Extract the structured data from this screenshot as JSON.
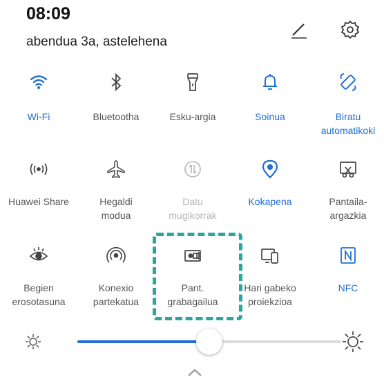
{
  "status": {
    "time": "08:09",
    "date": "abendua 3a, astelehena"
  },
  "header_icons": [
    "edit-icon",
    "settings-gear-icon"
  ],
  "tiles": [
    {
      "label": "Wi-Fi",
      "icon": "wifi-icon",
      "state": "active"
    },
    {
      "label": "Bluetootha",
      "icon": "bluetooth-icon",
      "state": "off"
    },
    {
      "label": "Esku-argia",
      "icon": "flashlight-icon",
      "state": "off"
    },
    {
      "label": "Soinua",
      "icon": "bell-icon",
      "state": "active"
    },
    {
      "label": "Biratu\nautomatikoki",
      "icon": "auto-rotate-icon",
      "state": "active"
    },
    {
      "label": "Huawei Share",
      "icon": "huawei-share-icon",
      "state": "off"
    },
    {
      "label": "Hegaldi\nmodua",
      "icon": "airplane-icon",
      "state": "off"
    },
    {
      "label": "Datu\nmugikorrak",
      "icon": "mobile-data-icon",
      "state": "disabled"
    },
    {
      "label": "Kokapena",
      "icon": "location-icon",
      "state": "active"
    },
    {
      "label": "Pantaila-\nargazkia",
      "icon": "screenshot-icon",
      "state": "off"
    },
    {
      "label": "Begien\nerosotasuna",
      "icon": "eye-comfort-icon",
      "state": "off"
    },
    {
      "label": "Konexio\npartekatua",
      "icon": "hotspot-icon",
      "state": "off"
    },
    {
      "label": "Pant.\ngrabagailua",
      "icon": "screen-recorder-icon",
      "state": "off"
    },
    {
      "label": "Hari gabeko\nproiekzioa",
      "icon": "wireless-projection-icon",
      "state": "off"
    },
    {
      "label": "NFC",
      "icon": "nfc-icon",
      "state": "active"
    }
  ],
  "brightness": {
    "level": 0.5
  },
  "colors": {
    "accent": "#1f6fd6",
    "highlight": "#2aa5a0",
    "disabled": "#b5b5b5"
  }
}
